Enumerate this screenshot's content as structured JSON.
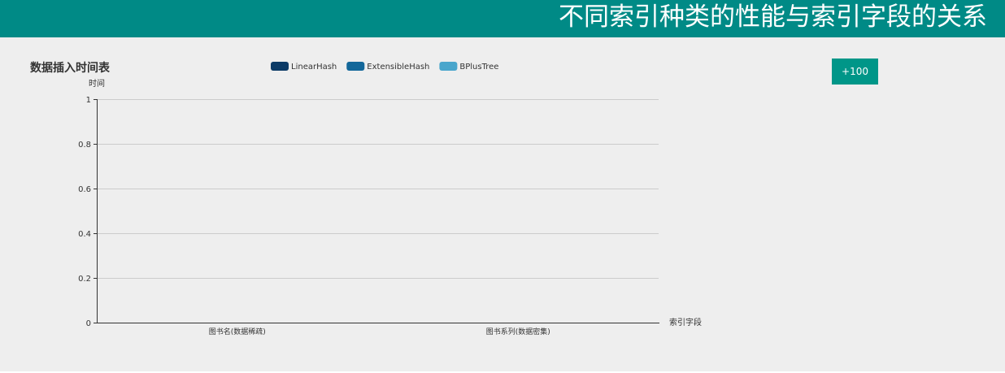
{
  "header": {
    "title": "不同索引种类的性能与索引字段的关系"
  },
  "panel": {
    "add_button_label": "+100"
  },
  "chart_data": {
    "type": "bar",
    "title": "数据插入时间表",
    "xlabel": "索引字段",
    "ylabel": "时间",
    "categories": [
      "图书名(数据稀疏)",
      "图书系列(数据密集)"
    ],
    "series": [
      {
        "name": "LinearHash",
        "color": "#0b3a66",
        "values": [
          null,
          null
        ]
      },
      {
        "name": "ExtensibleHash",
        "color": "#13679a",
        "values": [
          null,
          null
        ]
      },
      {
        "name": "BPlusTree",
        "color": "#4aa6cc",
        "values": [
          null,
          null
        ]
      }
    ],
    "ylim": [
      0,
      1
    ],
    "yticks": [
      "0",
      "0.2",
      "0.4",
      "0.6",
      "0.8",
      "1"
    ],
    "grid": true,
    "legend_position": "top-center",
    "colors": {
      "header": "#008a86",
      "button": "#009688",
      "panel": "#eeeeee"
    }
  }
}
